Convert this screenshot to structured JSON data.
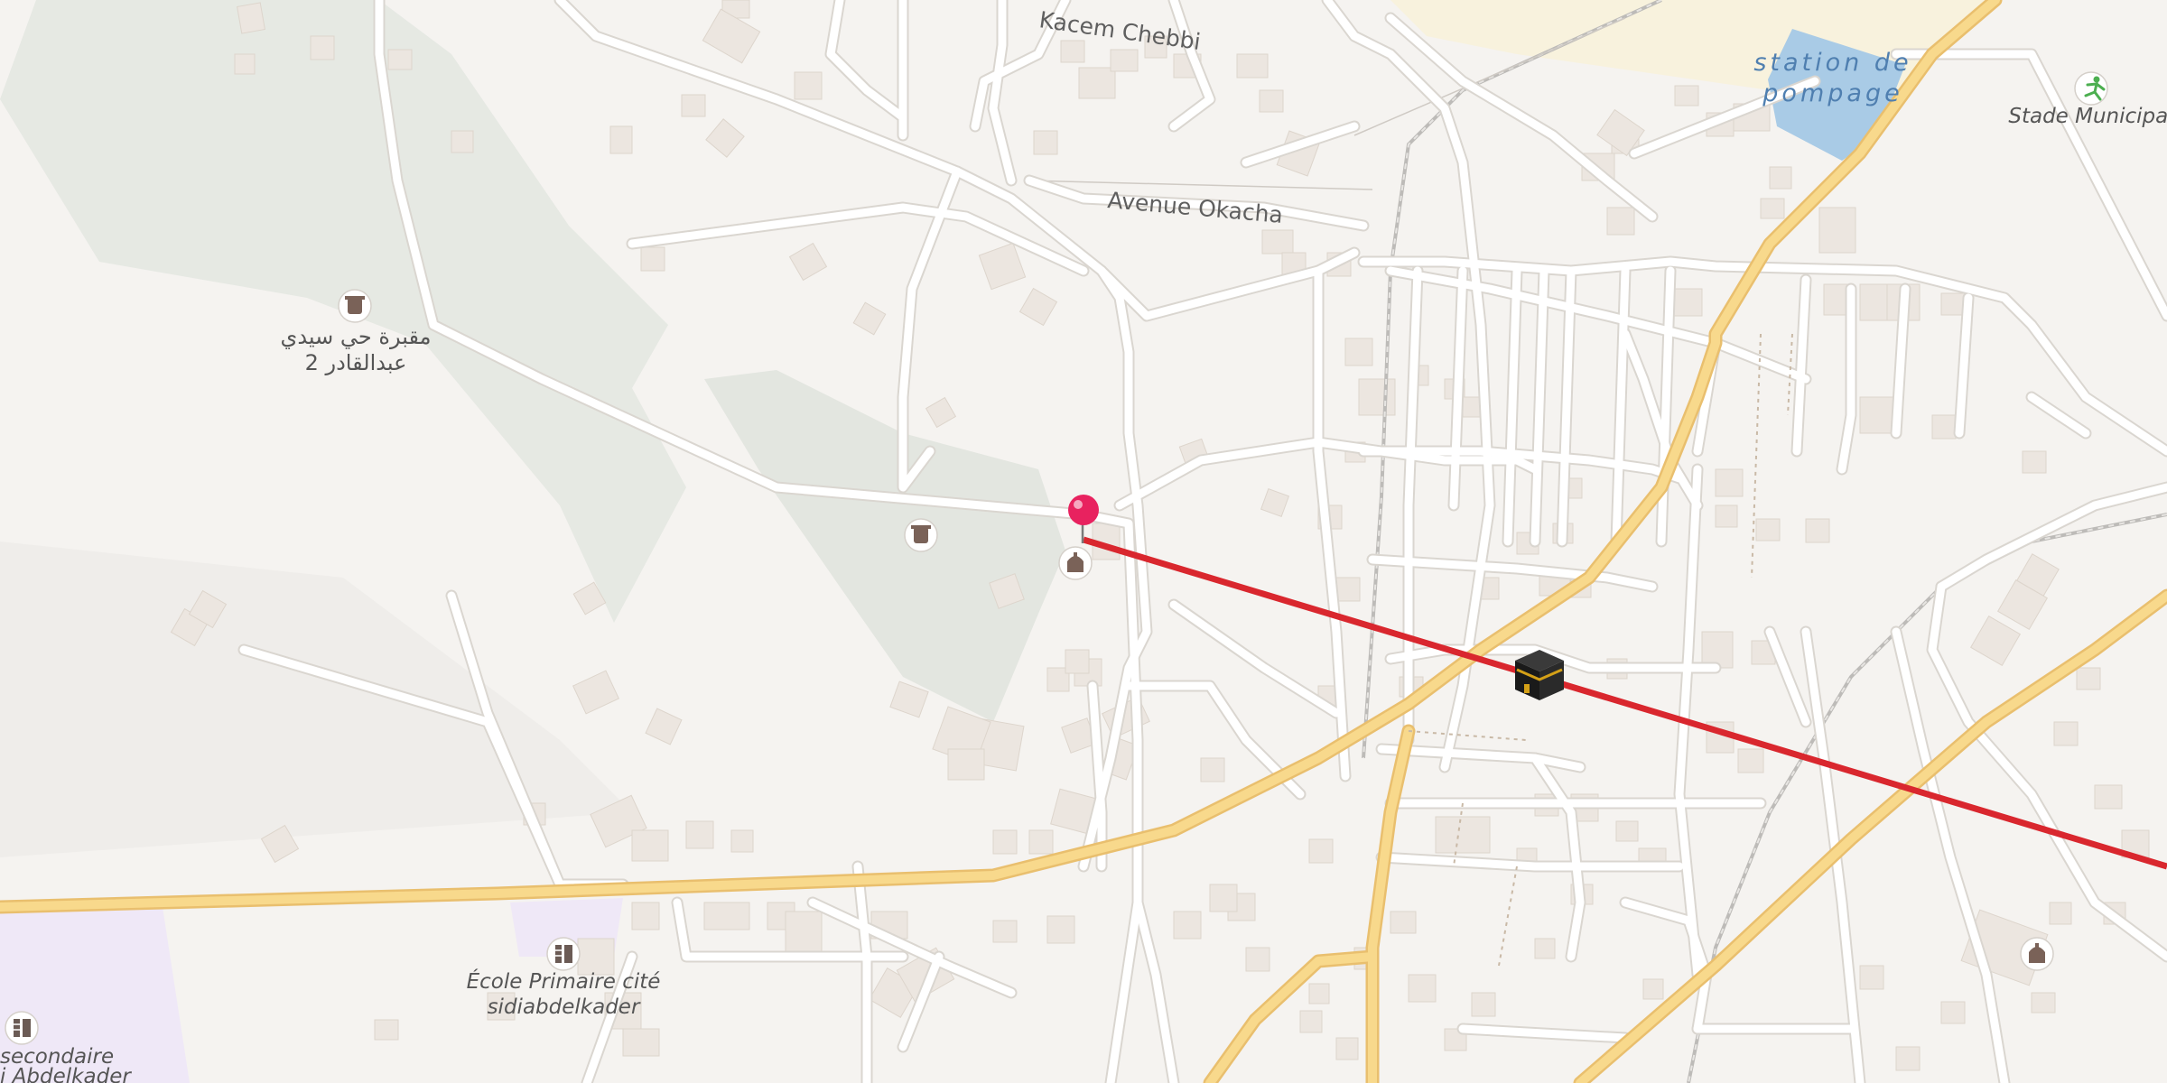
{
  "map": {
    "labels": {
      "road_kacem": "Kacem Chebbi",
      "road_okacha": "Avenue Okacha",
      "water_line1": "station de",
      "water_line2": "pompage",
      "stadium": "Stade Municipal",
      "cemetery_line1": "مقبرة حي سيدي",
      "cemetery_line2": "عبدالقادر 2",
      "school_line1": "École Primaire cité",
      "school_line2": "sidiabdelkader",
      "secondary_line1": "secondaire",
      "secondary_line2": "i Abdelkader"
    },
    "icons": {
      "cemetery": "cemetery-icon",
      "mosque": "mosque-icon",
      "kaaba": "kaaba-icon",
      "pin": "location-pin-icon",
      "school": "school-icon",
      "stadium": "sports-icon"
    },
    "colors": {
      "background": "#f5f3f0",
      "road": "#ffffff",
      "main_road": "#f8d98c",
      "main_road_casing": "#e9bf6e",
      "park": "#e3e6e0",
      "water": "#a9cbe6",
      "school_area": "#efe8f7",
      "building": "#ece6e0",
      "qibla_line": "#d9272e",
      "pin": "#e8225f"
    }
  }
}
